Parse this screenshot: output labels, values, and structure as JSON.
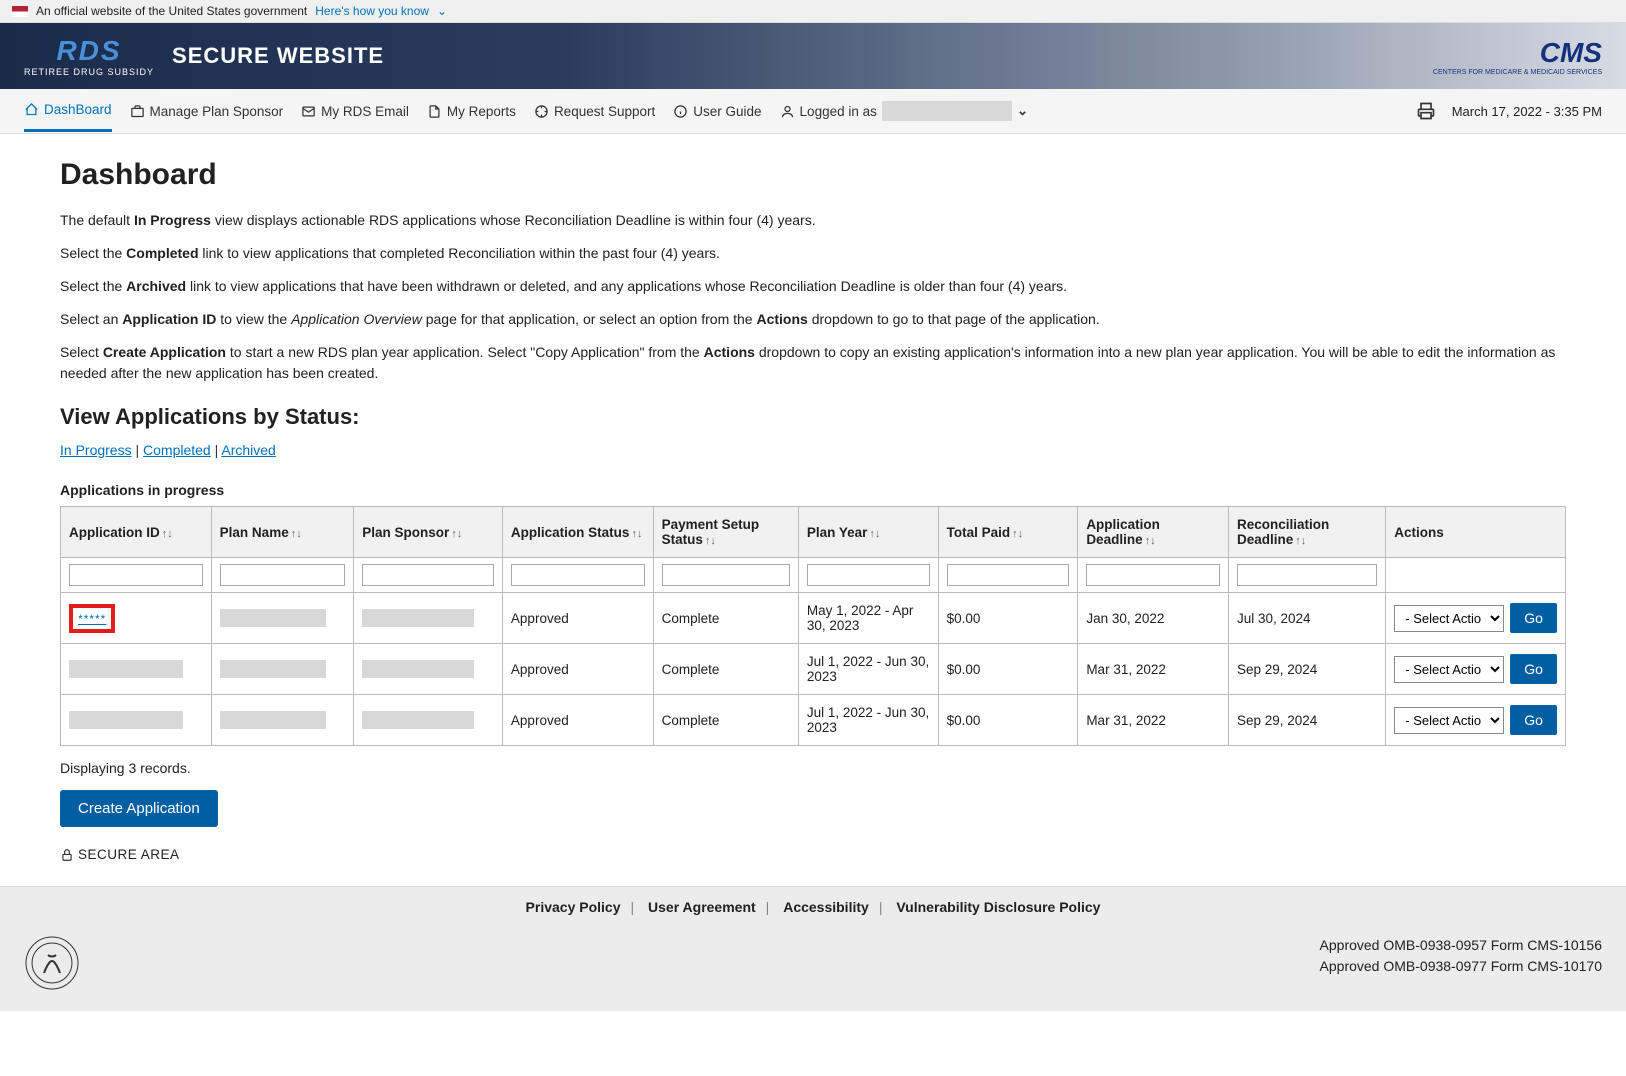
{
  "gov_banner": {
    "text": "An official website of the United States government",
    "link": "Here's how you know"
  },
  "header": {
    "rds": "RDS",
    "rds_sub": "RETIREE DRUG SUBSIDY",
    "secure": "SECURE WEBSITE",
    "cms": "CMS",
    "cms_sub": "CENTERS FOR MEDICARE & MEDICAID SERVICES"
  },
  "nav": {
    "items": [
      {
        "label": "DashBoard"
      },
      {
        "label": "Manage Plan Sponsor"
      },
      {
        "label": "My RDS Email"
      },
      {
        "label": "My Reports"
      },
      {
        "label": "Request Support"
      },
      {
        "label": "User Guide"
      }
    ],
    "logged_in": "Logged in as",
    "timestamp": "March 17, 2022 - 3:35 PM"
  },
  "page": {
    "title": "Dashboard",
    "p1_pre": "The default ",
    "p1_b1": "In Progress",
    "p1_post": " view displays actionable RDS applications whose Reconciliation Deadline is within four (4) years.",
    "p2_pre": "Select the ",
    "p2_b1": "Completed",
    "p2_post": " link to view applications that completed Reconciliation within the past four (4) years.",
    "p3_pre": "Select the ",
    "p3_b1": "Archived",
    "p3_post": " link to view applications that have been withdrawn or deleted, and any applications whose Reconciliation Deadline is older than four (4) years.",
    "p4_pre": "Select an ",
    "p4_b1": "Application ID",
    "p4_mid1": " to view the ",
    "p4_i1": "Application Overview",
    "p4_mid2": " page for that application, or select an option from the ",
    "p4_b2": "Actions",
    "p4_post": " dropdown to go to that page of the application.",
    "p5_pre": "Select ",
    "p5_b1": "Create Application",
    "p5_mid1": " to start a new RDS plan year application. Select \"Copy Application\" from the ",
    "p5_b2": "Actions",
    "p5_post": " dropdown to copy an existing application's information into a new plan year application. You will be able to edit the information as needed after the new application has been created.",
    "h2": "View Applications by Status:",
    "links": {
      "in_progress": "In Progress",
      "completed": "Completed",
      "archived": "Archived"
    },
    "table_title": "Applications in progress",
    "headers": [
      "Application ID",
      "Plan Name",
      "Plan Sponsor",
      "Application Status",
      "Payment Setup Status",
      "Plan Year",
      "Total Paid",
      "Application Deadline",
      "Reconciliation Deadline",
      "Actions"
    ],
    "rows": [
      {
        "app_id": "*****",
        "highlighted": true,
        "status": "Approved",
        "payment": "Complete",
        "plan_year": "May 1, 2022 - Apr 30, 2023",
        "total_paid": "$0.00",
        "app_deadline": "Jan 30, 2022",
        "rec_deadline": "Jul 30, 2024"
      },
      {
        "app_id": "",
        "highlighted": false,
        "status": "Approved",
        "payment": "Complete",
        "plan_year": "Jul 1, 2022 - Jun 30, 2023",
        "total_paid": "$0.00",
        "app_deadline": "Mar 31, 2022",
        "rec_deadline": "Sep 29, 2024"
      },
      {
        "app_id": "",
        "highlighted": false,
        "status": "Approved",
        "payment": "Complete",
        "plan_year": "Jul 1, 2022 - Jun 30, 2023",
        "total_paid": "$0.00",
        "app_deadline": "Mar 31, 2022",
        "rec_deadline": "Sep 29, 2024"
      }
    ],
    "select_action": "- Select Action -",
    "go": "Go",
    "records": "Displaying 3 records.",
    "create_btn": "Create Application",
    "secure_area": "SECURE AREA"
  },
  "footer": {
    "links": [
      "Privacy Policy",
      "User Agreement",
      "Accessibility",
      "Vulnerability Disclosure Policy"
    ],
    "omb1": "Approved OMB-0938-0957 Form CMS-10156",
    "omb2": "Approved OMB-0938-0977 Form CMS-10170"
  }
}
